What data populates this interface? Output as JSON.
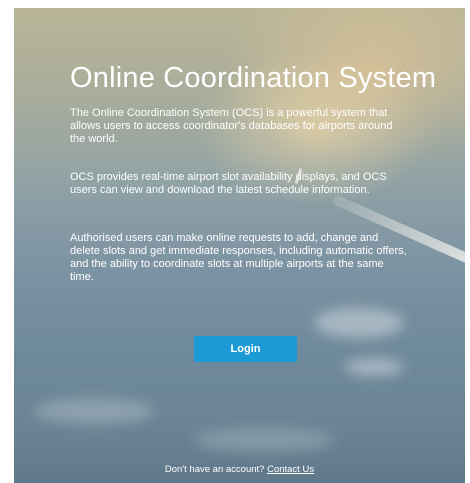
{
  "page": {
    "title": "Online Coordination System",
    "paragraphs": [
      "The Online Coordination System (OCS) is a powerful system that allows users to access coordinator's databases for airports around the world.",
      "OCS provides real-time airport slot availability displays, and OCS users can view and download the latest schedule information.",
      "Authorised users can make online requests to add, change and delete slots and get immediate responses, including automatic offers, and the ability to coordinate slots at multiple airports at the same time."
    ],
    "login_label": "Login",
    "footer_text": "Don't have an account?",
    "contact_link": "Contact Us"
  },
  "colors": {
    "button": "#1c9ad6",
    "text": "#ffffff"
  }
}
